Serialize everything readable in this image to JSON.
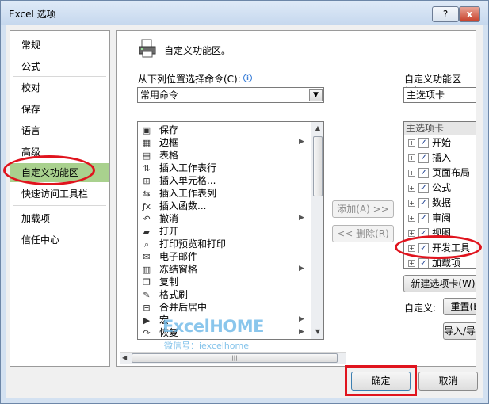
{
  "window": {
    "title": "Excel 选项",
    "help_label": "?",
    "close_label": "x"
  },
  "nav": {
    "items": [
      "常规",
      "公式",
      "校对",
      "保存",
      "语言",
      "高级",
      "自定义功能区",
      "快速访问工具栏",
      "加载项",
      "信任中心"
    ],
    "selected": "自定义功能区"
  },
  "panel": {
    "heading": "自定义功能区。",
    "left_label": "从下列位置选择命令(C):",
    "left_combo": "常用命令",
    "right_label": "自定义功能区(B):",
    "right_combo": "主选项卡",
    "commands": [
      {
        "label": "保存",
        "icon": "save-icon",
        "glyph": "▣",
        "sub": false
      },
      {
        "label": "边框",
        "icon": "border-icon",
        "glyph": "▦",
        "sub": true
      },
      {
        "label": "表格",
        "icon": "table-icon",
        "glyph": "▤",
        "sub": false
      },
      {
        "label": "插入工作表行",
        "icon": "insert-row-icon",
        "glyph": "⇅",
        "sub": false
      },
      {
        "label": "插入单元格...",
        "icon": "insert-cell-icon",
        "glyph": "⊞",
        "sub": false
      },
      {
        "label": "插入工作表列",
        "icon": "insert-column-icon",
        "glyph": "⇆",
        "sub": false
      },
      {
        "label": "插入函数...",
        "icon": "function-icon",
        "glyph": "ƒx",
        "sub": false
      },
      {
        "label": "撤消",
        "icon": "undo-icon",
        "glyph": "↶",
        "sub": true
      },
      {
        "label": "打开",
        "icon": "open-folder-icon",
        "glyph": "▰",
        "sub": false
      },
      {
        "label": "打印预览和打印",
        "icon": "print-preview-icon",
        "glyph": "⌕",
        "sub": false
      },
      {
        "label": "电子邮件",
        "icon": "email-icon",
        "glyph": "✉",
        "sub": false
      },
      {
        "label": "冻结窗格",
        "icon": "freeze-panes-icon",
        "glyph": "▥",
        "sub": true
      },
      {
        "label": "复制",
        "icon": "copy-icon",
        "glyph": "❐",
        "sub": false
      },
      {
        "label": "格式刷",
        "icon": "format-painter-icon",
        "glyph": "✎",
        "sub": false
      },
      {
        "label": "合并后居中",
        "icon": "merge-center-icon",
        "glyph": "⊟",
        "sub": false
      },
      {
        "label": "宏",
        "icon": "macro-icon",
        "glyph": "▶",
        "sub": true
      },
      {
        "label": "恢复",
        "icon": "redo-icon",
        "glyph": "↷",
        "sub": true
      }
    ],
    "add_button": "添加(A) >>",
    "remove_button": "<< 删除(R)",
    "tree_header": "主选项卡",
    "tree_items": [
      {
        "label": "开始",
        "checked": true
      },
      {
        "label": "插入",
        "checked": true
      },
      {
        "label": "页面布局",
        "checked": true
      },
      {
        "label": "公式",
        "checked": true
      },
      {
        "label": "数据",
        "checked": true
      },
      {
        "label": "审阅",
        "checked": true
      },
      {
        "label": "视图",
        "checked": true
      },
      {
        "label": "开发工具",
        "checked": true
      },
      {
        "label": "加载项",
        "checked": true
      }
    ],
    "new_tab_button": "新建选项卡(W)",
    "custom_label": "自定义:",
    "reset_button": "重置(E)",
    "import_button": "导入/导出(P)"
  },
  "watermark": {
    "brand": "ExcelHOME",
    "sub": "微信号：iexcelhome"
  },
  "footer": {
    "ok_button": "确定",
    "cancel_button": "取消"
  },
  "colors": {
    "selected_nav": "#a9d18e",
    "highlight_red": "#e0141e",
    "watermark": "#64b4e6"
  }
}
